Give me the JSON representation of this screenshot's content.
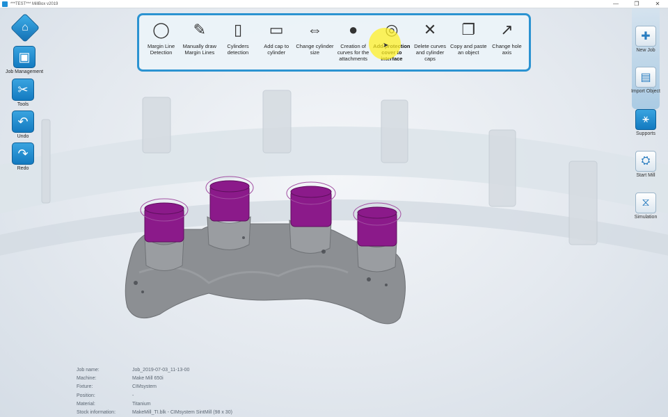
{
  "window": {
    "title": "***TEST*** MillBox v2019",
    "controls": [
      "—",
      "❐",
      "✕"
    ]
  },
  "left_toolbar": {
    "home_icon": "home-icon",
    "items": [
      {
        "label": "Job Management",
        "icon": "job-management-icon"
      },
      {
        "label": "Tools",
        "icon": "tools-icon"
      },
      {
        "label": "Undo",
        "icon": "undo-icon"
      },
      {
        "label": "Redo",
        "icon": "redo-icon"
      }
    ]
  },
  "top_toolbar": {
    "tools": [
      {
        "label": "Margin Line Detection",
        "icon": "margin-line-icon"
      },
      {
        "label": "Manually draw Margin Lines",
        "icon": "draw-margin-icon"
      },
      {
        "label": "Cylinders detection",
        "icon": "cylinder-detect-icon"
      },
      {
        "label": "Add cap to cylinder",
        "icon": "add-cap-icon"
      },
      {
        "label": "Change cylinder size",
        "icon": "cylinder-size-icon"
      },
      {
        "label": "Creation of curves for the attachments",
        "icon": "attachment-curves-icon"
      },
      {
        "label": "Add protection cover to interface",
        "icon": "protection-cover-icon"
      },
      {
        "label": "Delete curves and cylinder caps",
        "icon": "delete-curves-icon"
      },
      {
        "label": "Copy and paste an object",
        "icon": "copy-paste-icon"
      },
      {
        "label": "Change hole axis",
        "icon": "hole-axis-icon"
      }
    ]
  },
  "right_toolbar": {
    "items": [
      {
        "label": "New Job",
        "icon": "new-job-icon",
        "active": false
      },
      {
        "label": "Import Object",
        "icon": "import-object-icon",
        "active": false
      },
      {
        "label": "Supports",
        "icon": "supports-icon",
        "active": true
      },
      {
        "label": "Start Mill",
        "icon": "start-mill-icon",
        "active": false
      },
      {
        "label": "Simulation",
        "icon": "simulation-icon",
        "active": false
      }
    ]
  },
  "info": {
    "rows": [
      {
        "key": "Job name:",
        "value": "Job_2019-07-03_11-13-00"
      },
      {
        "key": "Machine:",
        "value": "Make Mill 650i"
      },
      {
        "key": "Fixture:",
        "value": "CIMsystem"
      },
      {
        "key": "Position:",
        "value": "-"
      },
      {
        "key": "Material:",
        "value": "Titanium"
      },
      {
        "key": "Stock information:",
        "value": "MakeMill_TI.blk - CIMsystem SintMill (98 x 30)"
      }
    ]
  },
  "colors": {
    "accent": "#2b93d1",
    "cap": "#8b1a8a",
    "model": "#8c8f93"
  }
}
